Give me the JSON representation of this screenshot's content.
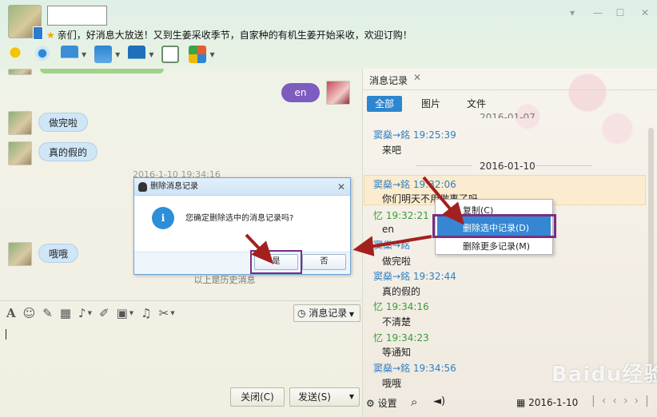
{
  "window": {
    "signature": "亲们，好消息大放送！又到生姜采收季节，自家种的有机生姜开始采收，欢迎订购！",
    "controls": [
      "▾",
      "—",
      "☐",
      "✕"
    ]
  },
  "chat": {
    "messages": [
      {
        "text": "en",
        "side": "right"
      },
      {
        "text": "做完啦",
        "side": "left"
      },
      {
        "text": "真的假的",
        "side": "left"
      },
      {
        "text": "哦哦",
        "side": "left"
      }
    ],
    "timestamp": "2016-1-10 19:34:16",
    "history_divider": "以上是历史消息"
  },
  "dialog": {
    "title": "删除消息记录",
    "info_glyph": "i",
    "message": "您确定删除选中的消息记录吗?",
    "yes_label": "是",
    "no_label": "否",
    "close_glyph": "✕"
  },
  "input": {
    "history_button": "消息记录",
    "close_button": "关闭(C)",
    "send_button": "发送(S)"
  },
  "history_panel": {
    "tab_title": "消息记录",
    "filters": [
      "全部",
      "图片",
      "文件"
    ],
    "date_top": "2016-01-07",
    "date_mid": "2016-01-10",
    "records": [
      {
        "name": "窦燊→銘",
        "time": "19:25:39",
        "text": "来吧",
        "color": "blue"
      },
      {
        "name": "窦燊→銘",
        "time": "19:32:06",
        "text": "你们明天不用做事了吗",
        "color": "blue"
      },
      {
        "name": "忆",
        "time": "19:32:21",
        "text": "en",
        "color": "green"
      },
      {
        "name": "窦燊→銘",
        "time": "",
        "text": "做完啦",
        "color": "blue"
      },
      {
        "name": "窦燊→銘",
        "time": "19:32:44",
        "text": "真的假的",
        "color": "blue"
      },
      {
        "name": "忆",
        "time": "19:34:16",
        "text": "不清楚",
        "color": "green"
      },
      {
        "name": "忆",
        "time": "19:34:23",
        "text": "等通知",
        "color": "green"
      },
      {
        "name": "窦燊→銘",
        "time": "19:34:56",
        "text": "哦哦",
        "color": "blue"
      }
    ],
    "footer": {
      "settings_label": "设置",
      "date": "2016-1-10"
    }
  },
  "context_menu": {
    "items": [
      "复制(C)",
      "删除选中记录(D)",
      "删除更多记录(M)"
    ]
  },
  "watermark": "Baidu经验",
  "colors": {
    "accent": "#2d86cf",
    "highlight_frame": "#7a2f83",
    "arrow": "#a3201e"
  }
}
